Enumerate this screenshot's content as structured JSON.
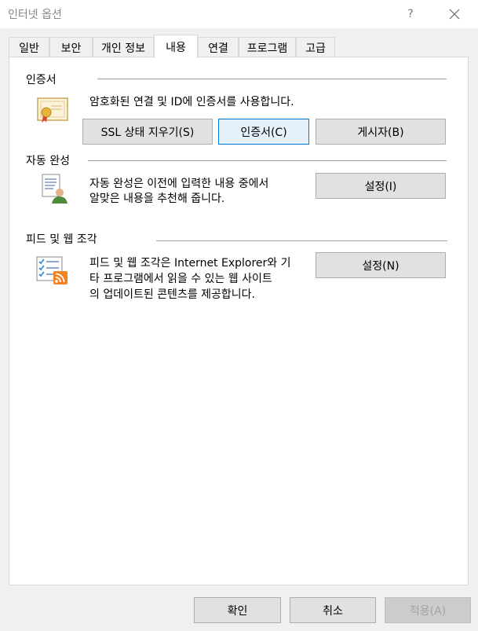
{
  "window": {
    "title": "인터넷 옵션",
    "help_label": "?",
    "close_label": "✕"
  },
  "tabs": [
    {
      "label": "일반"
    },
    {
      "label": "보안"
    },
    {
      "label": "개인 정보"
    },
    {
      "label": "내용"
    },
    {
      "label": "연결"
    },
    {
      "label": "프로그램"
    },
    {
      "label": "고급"
    }
  ],
  "certificates": {
    "title": "인증서",
    "description": "암호화된 연결 및 ID에 인증서를 사용합니다.",
    "clear_ssl_label": "SSL 상태 지우기(S)",
    "certificates_label": "인증서(C)",
    "publishers_label": "게시자(B)"
  },
  "autocomplete": {
    "title": "자동 완성",
    "description_line1": "자동 완성은 이전에 입력한 내용 중에서",
    "description_line2": "알맞은 내용을 추천해 줍니다.",
    "settings_label": "설정(I)"
  },
  "feeds": {
    "title": "피드 및 웹 조각",
    "description_line1": "피드 및 웹 조각은 Internet Explorer와 기",
    "description_line2": "타 프로그램에서 읽을 수 있는 웹 사이트",
    "description_line3": "의 업데이트된 콘텐츠를 제공합니다.",
    "settings_label": "설정(N)"
  },
  "footer": {
    "ok_label": "확인",
    "cancel_label": "취소",
    "apply_label": "적용(A)"
  }
}
